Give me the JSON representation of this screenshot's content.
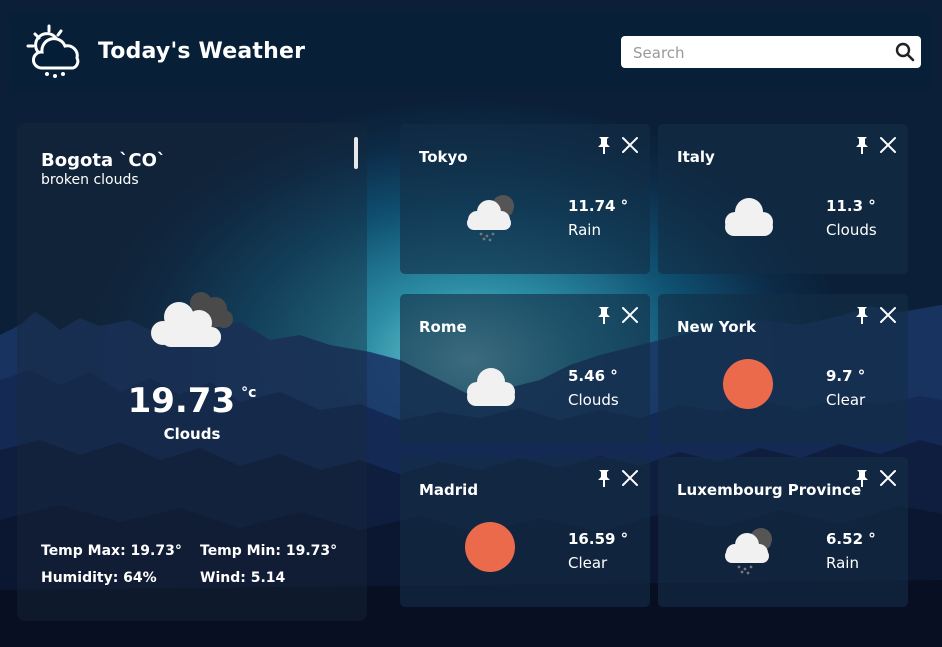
{
  "header": {
    "title": "Today's Weather",
    "search_placeholder": "Search"
  },
  "main": {
    "city": "Bogota `CO`",
    "description": "broken clouds",
    "icon": "cloudy-icon",
    "temperature": "19.73",
    "unit": "°c",
    "condition": "Clouds",
    "temp_max": "Temp Max: 19.73°",
    "temp_min": "Temp Min: 19.73°",
    "humidity": "Humidity: 64%",
    "wind": "Wind: 5.14"
  },
  "cities": [
    {
      "name": "Tokyo",
      "temp": "11.74 °",
      "condition": "Rain",
      "icon": "rain-cloud-icon"
    },
    {
      "name": "Italy",
      "temp": "11.3 °",
      "condition": "Clouds",
      "icon": "cloud-icon"
    },
    {
      "name": "Rome",
      "temp": "5.46 °",
      "condition": "Clouds",
      "icon": "cloud-icon"
    },
    {
      "name": "New York",
      "temp": "9.7 °",
      "condition": "Clear",
      "icon": "sun-icon"
    },
    {
      "name": "Madrid",
      "temp": "16.59 °",
      "condition": "Clear",
      "icon": "sun-icon"
    },
    {
      "name": "Luxembourg Province",
      "temp": "6.52 °",
      "condition": "Rain",
      "icon": "rain-cloud-icon"
    }
  ],
  "colors": {
    "sun": "#ec6a4c",
    "cloud": "#f1f1f1",
    "dark_cloud": "#555555"
  }
}
